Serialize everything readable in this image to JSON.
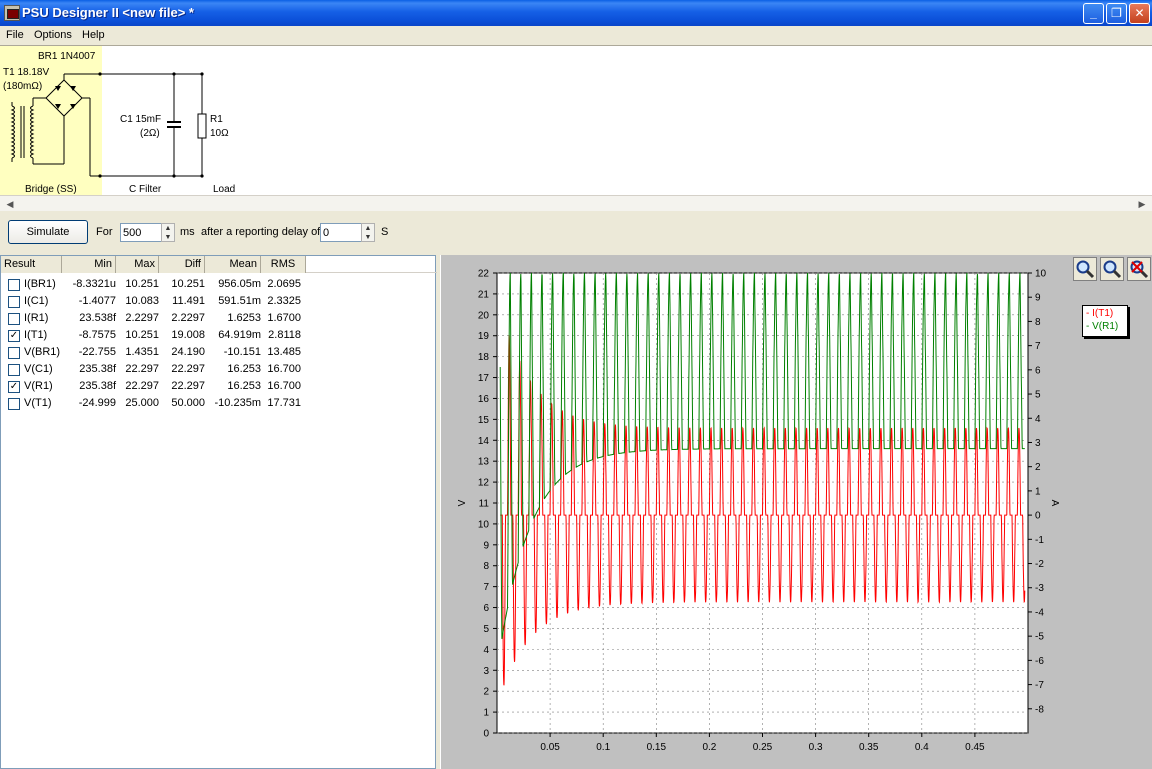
{
  "window": {
    "title": "PSU Designer II  <new file> *",
    "minimize": "_",
    "maximize": "❐",
    "close": "✕"
  },
  "menu": [
    "File",
    "Options",
    "Help"
  ],
  "schematic": {
    "bridge_name": "BR1 1N4007",
    "transformer_name": "T1 18.18V",
    "transformer_res": "(180mΩ)",
    "cap_name": "C1 15mF",
    "cap_res": "(2Ω)",
    "load_name": "R1",
    "load_value": "10Ω",
    "section_bridge": "Bridge (SS)",
    "section_filter": "C Filter",
    "section_load": "Load"
  },
  "toolbar": {
    "simulate_label": "Simulate",
    "for_label": "For",
    "duration_value": "500",
    "ms_label": "ms",
    "delay_label": "after a reporting delay of",
    "delay_value": "0",
    "s_label": "S"
  },
  "results": {
    "columns": [
      "Result",
      "Min",
      "Max",
      "Diff",
      "Mean",
      "RMS"
    ],
    "rows": [
      {
        "checked": false,
        "name": "I(BR1)",
        "min": "-8.3321u",
        "max": "10.251",
        "diff": "10.251",
        "mean": "956.05m",
        "rms": "2.0695"
      },
      {
        "checked": false,
        "name": "I(C1)",
        "min": "-1.4077",
        "max": "10.083",
        "diff": "11.491",
        "mean": "591.51m",
        "rms": "2.3325"
      },
      {
        "checked": false,
        "name": "I(R1)",
        "min": "23.538f",
        "max": "2.2297",
        "diff": "2.2297",
        "mean": "1.6253",
        "rms": "1.6700"
      },
      {
        "checked": true,
        "name": "I(T1)",
        "min": "-8.7575",
        "max": "10.251",
        "diff": "19.008",
        "mean": "64.919m",
        "rms": "2.8118"
      },
      {
        "checked": false,
        "name": "V(BR1)",
        "min": "-22.755",
        "max": "1.4351",
        "diff": "24.190",
        "mean": "-10.151",
        "rms": "13.485"
      },
      {
        "checked": false,
        "name": "V(C1)",
        "min": "235.38f",
        "max": "22.297",
        "diff": "22.297",
        "mean": "16.253",
        "rms": "16.700"
      },
      {
        "checked": true,
        "name": "V(R1)",
        "min": "235.38f",
        "max": "22.297",
        "diff": "22.297",
        "mean": "16.253",
        "rms": "16.700"
      },
      {
        "checked": false,
        "name": "V(T1)",
        "min": "-24.999",
        "max": "25.000",
        "diff": "50.000",
        "mean": "-10.235m",
        "rms": "17.731"
      }
    ]
  },
  "plot": {
    "zoom_buttons": [
      "zoom-in-icon",
      "zoom-fit-icon",
      "zoom-reset-icon"
    ],
    "legend": [
      "- I(T1)",
      "- V(R1)"
    ],
    "left_axis_label": "V",
    "right_axis_label": "A",
    "left_ticks": [
      "0",
      "1",
      "2",
      "3",
      "4",
      "5",
      "6",
      "7",
      "8",
      "9",
      "10",
      "11",
      "12",
      "13",
      "14",
      "15",
      "16",
      "17",
      "18",
      "19",
      "20",
      "21",
      "22"
    ],
    "right_ticks": [
      "-8",
      "-7",
      "-6",
      "-5",
      "-4",
      "-3",
      "-2",
      "-1",
      "0",
      "1",
      "2",
      "3",
      "4",
      "5",
      "6",
      "7",
      "8",
      "9",
      "10"
    ],
    "x_ticks": [
      "0.05",
      "0.1",
      "0.15",
      "0.2",
      "0.25",
      "0.3",
      "0.35",
      "0.4",
      "0.45"
    ],
    "colors": {
      "current": "#ff0000",
      "voltage": "#008000",
      "grid": "#808080"
    }
  },
  "chart_data": {
    "type": "line",
    "title": "",
    "xlabel": "",
    "ylabel": "V",
    "y2label": "A",
    "xlim": [
      0,
      0.5
    ],
    "ylim": [
      0,
      22
    ],
    "y2lim": [
      -9,
      10
    ],
    "grid": true,
    "legend_placement": "top-right",
    "series": [
      {
        "name": "I(T1)",
        "axis": "right",
        "color": "#ff0000",
        "period": 0.01,
        "min": -8.7575,
        "max": 10.251,
        "steady_min": -4.0,
        "steady_max": 4.0
      },
      {
        "name": "V(R1)",
        "axis": "left",
        "color": "#008000",
        "period": 0.01,
        "min": 0,
        "max": 22.297,
        "steady_min": 13.6,
        "steady_max": 22.0
      }
    ]
  }
}
